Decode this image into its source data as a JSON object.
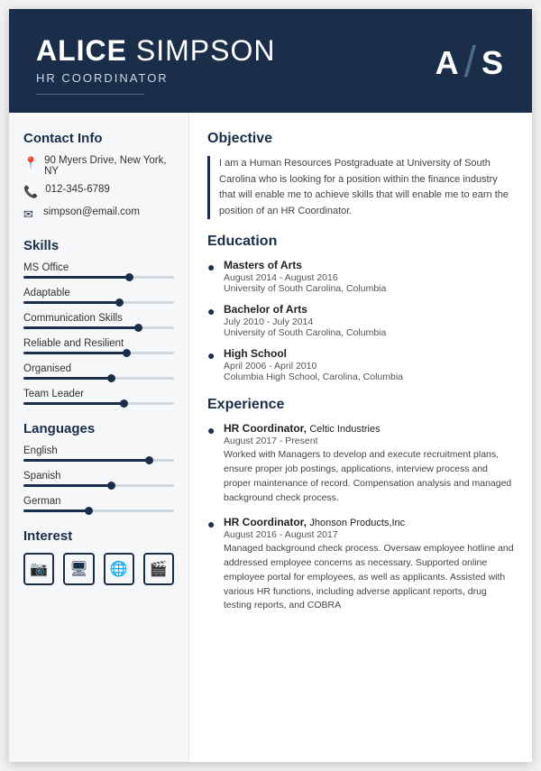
{
  "header": {
    "first_name": "ALICE",
    "last_name": " SIMPSON",
    "title": "HR COORDINATOR",
    "initial_a": "A",
    "slash": "/",
    "initial_s": "S"
  },
  "sidebar": {
    "contact_title": "Contact Info",
    "address": "90 Myers Drive, New York, NY",
    "phone": "012-345-6789",
    "email": "simpson@email.com",
    "skills_title": "Skills",
    "skills": [
      {
        "label": "MS Office",
        "pct": 72
      },
      {
        "label": "Adaptable",
        "pct": 65
      },
      {
        "label": "Communication Skills",
        "pct": 78
      },
      {
        "label": "Reliable and Resilient",
        "pct": 70
      },
      {
        "label": "Organised",
        "pct": 60
      },
      {
        "label": "Team Leader",
        "pct": 68
      }
    ],
    "languages_title": "Languages",
    "languages": [
      {
        "label": "English",
        "pct": 85
      },
      {
        "label": "Spanish",
        "pct": 60
      },
      {
        "label": "German",
        "pct": 45
      }
    ],
    "interest_title": "Interest",
    "interests": [
      "📷",
      "🖥",
      "🌐",
      "🎬"
    ]
  },
  "main": {
    "objective_title": "Objective",
    "objective_text": "I am a Human Resources Postgraduate at University of South Carolina who is looking for a position within the finance industry that will enable me to achieve skills that will enable me to earn the position of an HR Coordinator.",
    "education_title": "Education",
    "education": [
      {
        "degree": "Masters of Arts",
        "dates": "August 2014 - August 2016",
        "school": "University of South Carolina, Columbia"
      },
      {
        "degree": "Bachelor of Arts",
        "dates": "July 2010 - July 2014",
        "school": "University of South Carolina, Columbia"
      },
      {
        "degree": "High School",
        "dates": "April 2006 - April 2010",
        "school": "Columbia High School, Carolina, Columbia"
      }
    ],
    "experience_title": "Experience",
    "experience": [
      {
        "role": "HR Coordinator",
        "company": "Celtic Industries",
        "dates": "August 2017 - Present",
        "desc": "Worked with Managers to develop and execute recruitment plans, ensure proper job postings, applications, interview process and proper maintenance of record. Compensation analysis and managed background check process."
      },
      {
        "role": "HR Coordinator",
        "company": "Jhonson Products,Inc",
        "dates": "August 2016 - August 2017",
        "desc": "Managed background check process. Oversaw employee hotline and addressed employee concerns as necessary. Supported online employee portal for employees, as well as applicants. Assisted with various HR functions, including adverse applicant reports, drug testing reports, and COBRA"
      }
    ]
  }
}
